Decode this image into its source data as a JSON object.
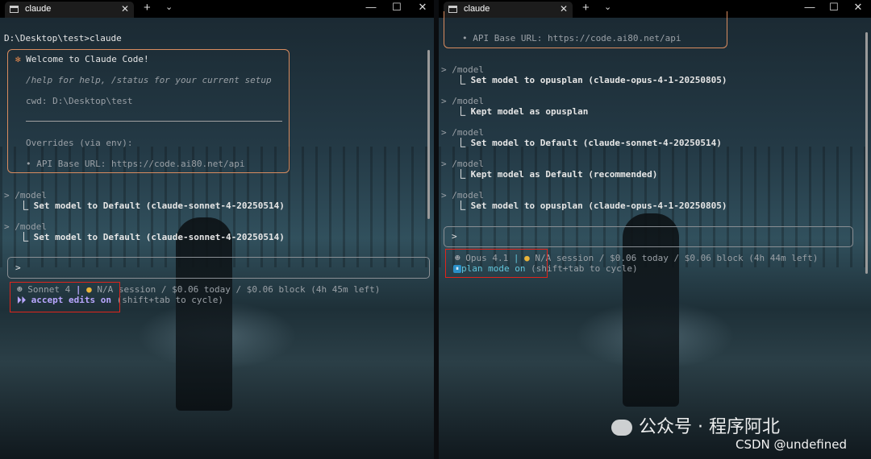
{
  "left": {
    "tab_title": "claude",
    "prompt_line": "D:\\Desktop\\test>claude",
    "welcome": {
      "title": "Welcome to Claude Code!",
      "help": "/help for help, /status for your current setup",
      "cwd": "cwd: D:\\Desktop\\test",
      "overrides": "Overrides (via env):",
      "api_base": "• API Base URL: https://code.ai80.net/api"
    },
    "history": [
      {
        "command": "> /model",
        "result": "⎿ Set model to Default (claude-sonnet-4-20250514)"
      },
      {
        "command": "> /model",
        "result": "⎿ Set model to Default (claude-sonnet-4-20250514)"
      }
    ],
    "input_prompt": ">",
    "status": {
      "model": "Sonnet 4",
      "separator": "|",
      "session": "N/A session / $0.06 today / $0.06 block (4h 45m left)",
      "mode_icon": "⏵⏵",
      "mode": "accept edits on",
      "hint": "(shift+tab to cycle)"
    }
  },
  "right": {
    "tab_title": "claude",
    "api_base": "• API Base URL: https://code.ai80.net/api",
    "history": [
      {
        "command": "> /model",
        "result": "⎿ Set model to opusplan (claude-opus-4-1-20250805)"
      },
      {
        "command": "> /model",
        "result": "⎿ Kept model as opusplan"
      },
      {
        "command": "> /model",
        "result": "⎿ Set model to Default (claude-sonnet-4-20250514)"
      },
      {
        "command": "> /model",
        "result": "⎿ Kept model as Default (recommended)"
      },
      {
        "command": "> /model",
        "result": "⎿ Set model to opusplan (claude-opus-4-1-20250805)"
      }
    ],
    "input_prompt": ">",
    "status": {
      "model": "Opus 4.1",
      "separator": "|",
      "session": "N/A session / $0.06 today / $0.06 block (4h 44m left)",
      "mode_icon": "⏸",
      "mode": "plan mode on",
      "hint": "(shift+tab to cycle)"
    }
  },
  "watermark": {
    "text": "公众号 · 程序阿北",
    "credit": "CSDN @undefined"
  },
  "colors": {
    "welcome_border": "#d98c5f",
    "highlight_box": "#e0241b",
    "accept_edits": "#b9a7ff",
    "plan_mode": "#62c4d9"
  }
}
